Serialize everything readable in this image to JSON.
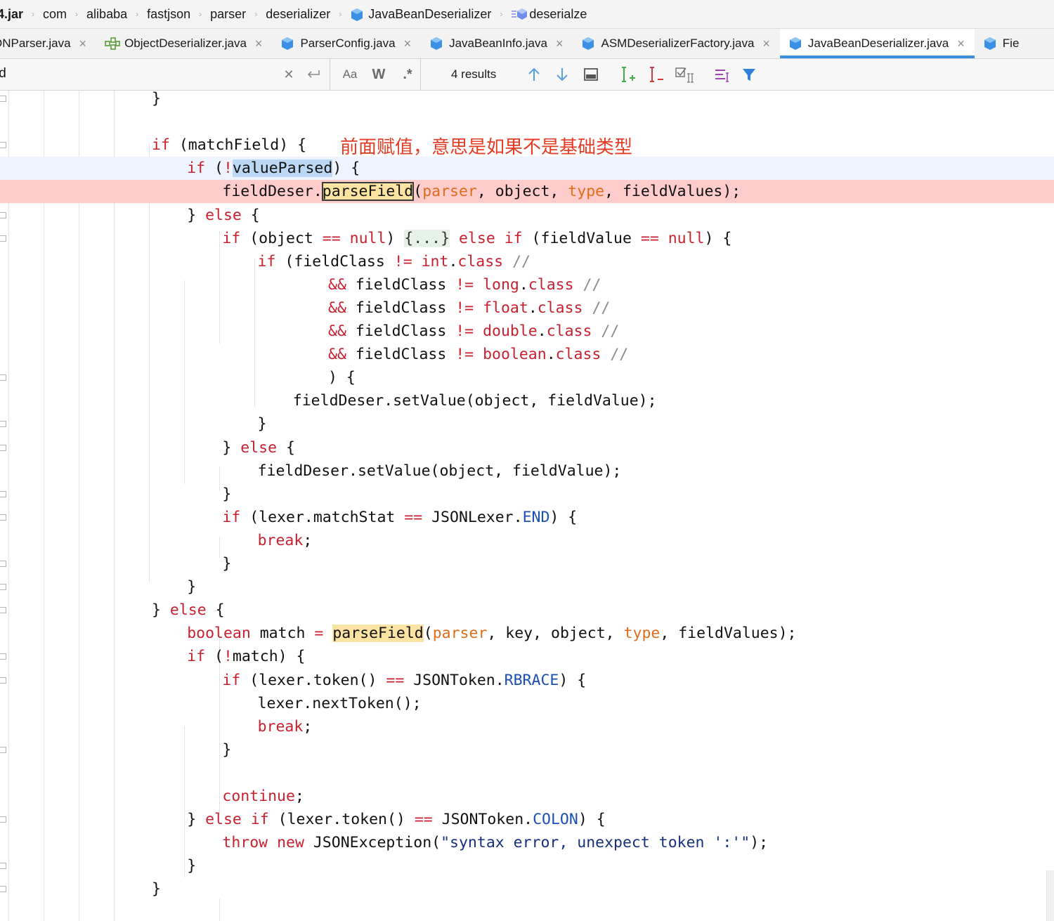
{
  "breadcrumb": {
    "items": [
      {
        "label": "4.jar"
      },
      {
        "label": "com"
      },
      {
        "label": "alibaba"
      },
      {
        "label": "fastjson"
      },
      {
        "label": "parser"
      },
      {
        "label": "deserializer"
      },
      {
        "label": "JavaBeanDeserializer",
        "icon": "class-icon"
      },
      {
        "label": "deserialze",
        "icon": "method-icon"
      }
    ]
  },
  "tabs": [
    {
      "label": "ONParser.java",
      "icon": "class-icon"
    },
    {
      "label": "ObjectDeserializer.java",
      "icon": "interface-icon"
    },
    {
      "label": "ParserConfig.java",
      "icon": "class-icon"
    },
    {
      "label": "JavaBeanInfo.java",
      "icon": "class-icon"
    },
    {
      "label": "ASMDeserializerFactory.java",
      "icon": "class-icon"
    },
    {
      "label": "JavaBeanDeserializer.java",
      "icon": "class-icon",
      "active": true
    },
    {
      "label": "Fie",
      "icon": "class-icon"
    }
  ],
  "search": {
    "query": "ld",
    "match_case_label": "Aa",
    "words_label": "W",
    "regex_label": ".*",
    "results": "4 results"
  },
  "annotation": "前面赋值，意思是如果不是基础类型",
  "code_lines": [
    "}",
    "",
    "if (matchField) {",
    "if (!valueParsed) {",
    "fieldDeser.parseField(parser, object, type, fieldValues);",
    "} else {",
    "if (object == null) {...} else if (fieldValue == null) {",
    "if (fieldClass != int.class //",
    "&& fieldClass != long.class //",
    "&& fieldClass != float.class //",
    "&& fieldClass != double.class //",
    "&& fieldClass != boolean.class //",
    ") {",
    "fieldDeser.setValue(object, fieldValue);",
    "}",
    "} else {",
    "fieldDeser.setValue(object, fieldValue);",
    "}",
    "if (lexer.matchStat == JSONLexer.END) {",
    "break;",
    "}",
    "}",
    "} else {",
    "boolean match = parseField(parser, key, object, type, fieldValues);",
    "if (!match) {",
    "if (lexer.token() == JSONToken.RBRACE) {",
    "lexer.nextToken();",
    "break;",
    "}",
    "",
    "continue;",
    "} else if (lexer.token() == JSONToken.COLON) {",
    "throw new JSONException(\"syntax error, unexpect token ':'\");",
    "}",
    "}"
  ],
  "colors": {
    "keyword": "#c8202f",
    "param": "#e06c1a",
    "constant": "#1b4fb4",
    "error_line": "#ffcccc",
    "caret_line": "#eef4fd",
    "annotation": "#e53b24",
    "tab_underline": "#3d8fe0"
  }
}
